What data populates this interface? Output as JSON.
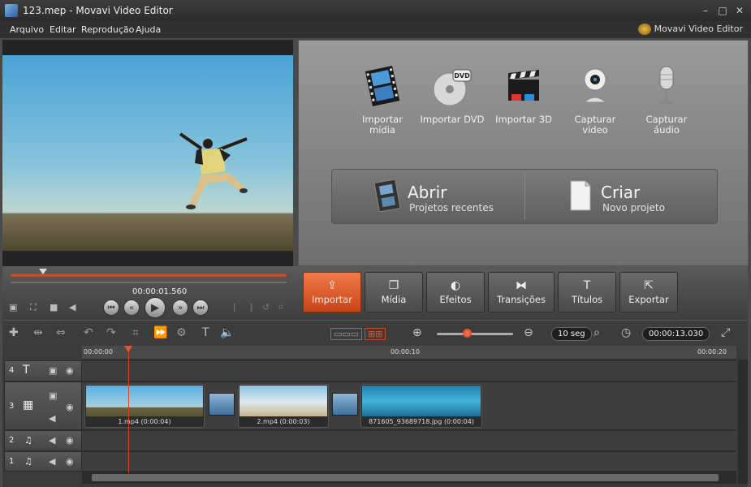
{
  "window": {
    "title": "123.mep - Movavi Video Editor",
    "min": "–",
    "max": "□",
    "close": "✕"
  },
  "menu": {
    "items": [
      "Arquivo",
      "Editar",
      "Reprodução",
      "Ajuda"
    ],
    "brand": "Movavi Video Editor"
  },
  "import_panel": {
    "buttons": [
      {
        "label": "Importar mídia",
        "icon": "film-strip-icon"
      },
      {
        "label": "Importar DVD",
        "icon": "dvd-disc-icon"
      },
      {
        "label": "Importar 3D",
        "icon": "clapperboard-3d-icon"
      },
      {
        "label": "Capturar vídeo",
        "icon": "webcam-icon"
      },
      {
        "label": "Capturar áudio",
        "icon": "microphone-icon"
      }
    ],
    "open": {
      "title": "Abrir",
      "subtitle": "Projetos recentes"
    },
    "create": {
      "title": "Criar",
      "subtitle": "Novo projeto"
    }
  },
  "player": {
    "timecode": "00:00:01.560"
  },
  "tabs": [
    {
      "label": "Importar",
      "icon": "⇪",
      "active": true
    },
    {
      "label": "Mídia",
      "icon": "❐",
      "active": false
    },
    {
      "label": "Efeitos",
      "icon": "◐",
      "active": false
    },
    {
      "label": "Transições",
      "icon": "⧓",
      "active": false
    },
    {
      "label": "Títulos",
      "icon": "T",
      "active": false
    },
    {
      "label": "Exportar",
      "icon": "⇱",
      "active": false
    }
  ],
  "toolbar": {
    "zoom_scale": "10 seg",
    "duration": "00:00:13.030",
    "zoom_level": 0.4
  },
  "timeline": {
    "ruler_labels": [
      "00:00:00",
      "00:00:10",
      "00:00:20"
    ],
    "tracks": [
      "4",
      "3",
      "2",
      "1"
    ],
    "clips": [
      {
        "label": "1.mp4 (0:00:04)"
      },
      {
        "label": "2.mp4 (0:00:03)"
      },
      {
        "label": "871605_93689718.jpg (0:00:04)"
      }
    ]
  },
  "colors": {
    "accent": "#e0582a",
    "panel": "#4a4a4a"
  }
}
